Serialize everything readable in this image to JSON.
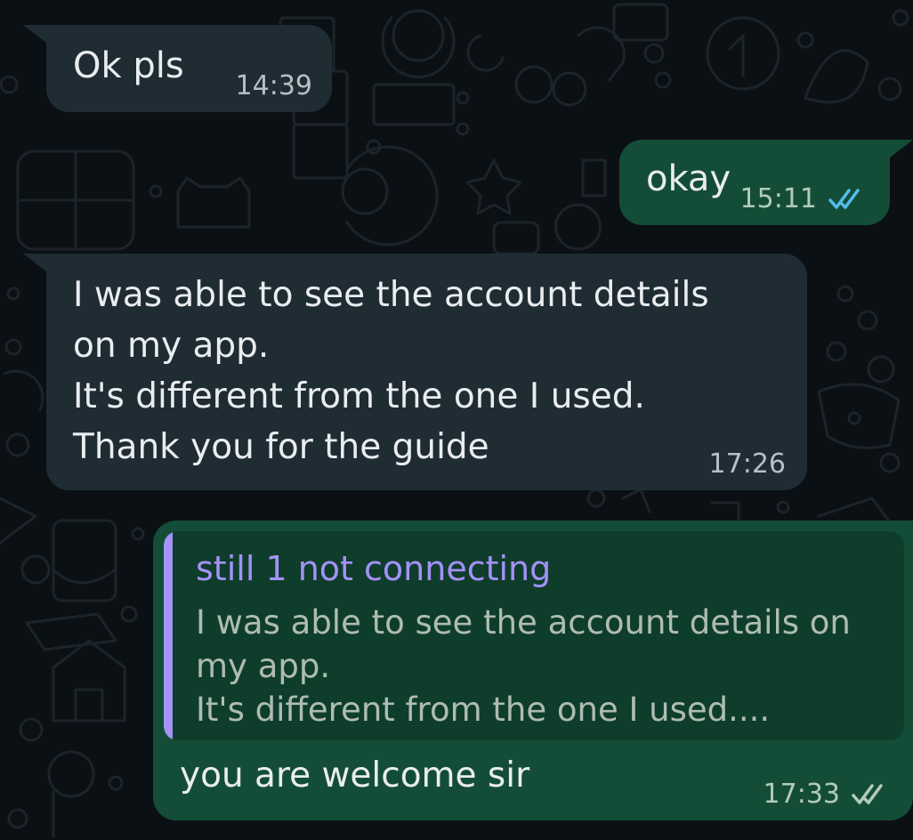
{
  "theme": {
    "background": "#0b1014",
    "incoming_bubble": "#1f2c34",
    "outgoing_bubble": "#144d37",
    "quote_background": "#0f3d2c",
    "quote_accent": "#a492f7",
    "read_ticks": "#53bdeb",
    "delivered_ticks": "#b1cbbd"
  },
  "messages": [
    {
      "direction": "incoming",
      "text": "Ok pls",
      "time": "14:39"
    },
    {
      "direction": "outgoing",
      "text": "okay",
      "time": "15:11",
      "status": "read",
      "status_icon": "double-check-icon"
    },
    {
      "direction": "incoming",
      "text": "I was able to see the account details\non my app.\nIt's different from the one I used.\nThank you for the guide",
      "time": "17:26"
    },
    {
      "direction": "outgoing",
      "quote": {
        "author": "still 1 not connecting",
        "text": "I was able to see the account details on\nmy app.\nIt's different from the one I used...."
      },
      "text": "you are welcome sir",
      "time": "17:33",
      "status": "delivered",
      "status_icon": "double-check-icon"
    }
  ]
}
